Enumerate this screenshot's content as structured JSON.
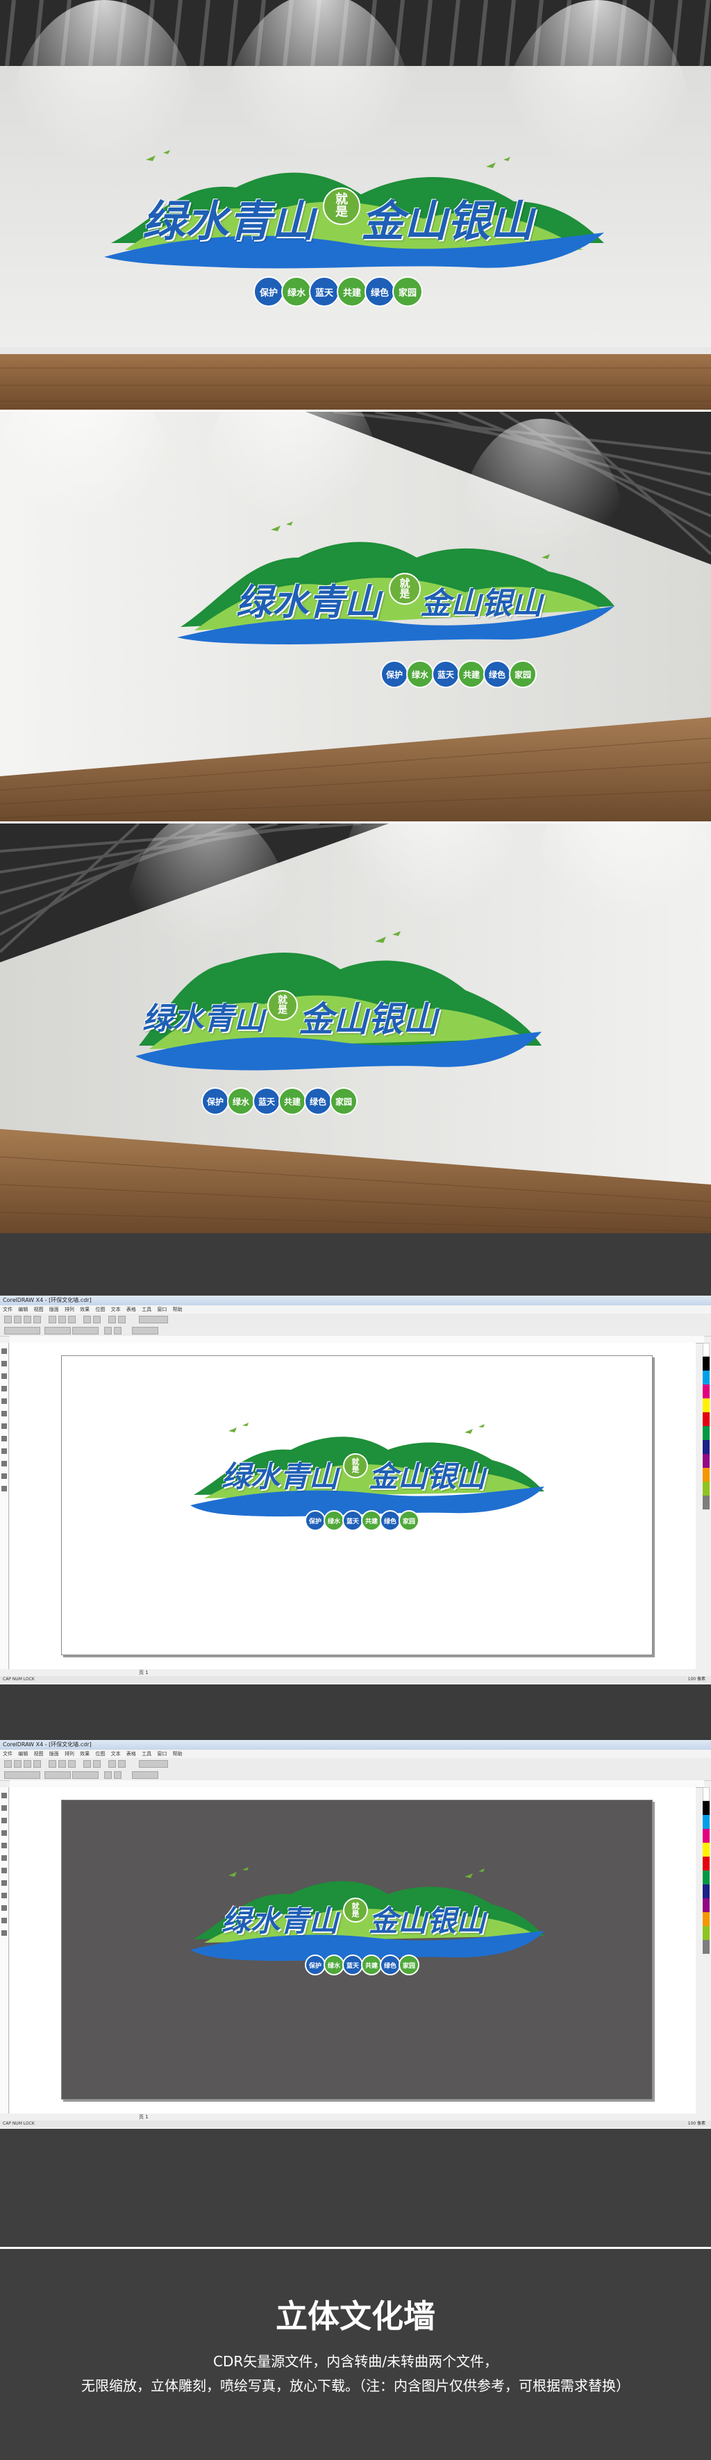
{
  "sign": {
    "slogan_part1": "绿水青山",
    "jiu_top": "就",
    "jiu_bottom": "是",
    "slogan_part2": "金山银山",
    "badges": [
      "保护",
      "绿水",
      "蓝天",
      "共建",
      "绿色",
      "家园"
    ]
  },
  "colors": {
    "green_dark": "#1e8f3a",
    "green_light": "#8fd14f",
    "blue": "#1f6fd1",
    "badge_blue": "#1e5fb8",
    "badge_green": "#4fa83a"
  },
  "app": {
    "title": "CorelDRAW X4 - [环保文化墙.cdr]",
    "menu": [
      "文件",
      "编辑",
      "视图",
      "版面",
      "排列",
      "效果",
      "位图",
      "文本",
      "表格",
      "工具",
      "窗口",
      "帮助"
    ],
    "page_tab": "页 1",
    "status_left": "CAP NUM LOCK",
    "status_right": "100 像素"
  },
  "footer": {
    "title": "立体文化墙",
    "line1": "CDR矢量源文件，内含转曲/未转曲两个文件，",
    "line2": "无限缩放，立体雕刻，喷绘写真，放心下载。（注：内含图片仅供参考，可根据需求替换）"
  }
}
